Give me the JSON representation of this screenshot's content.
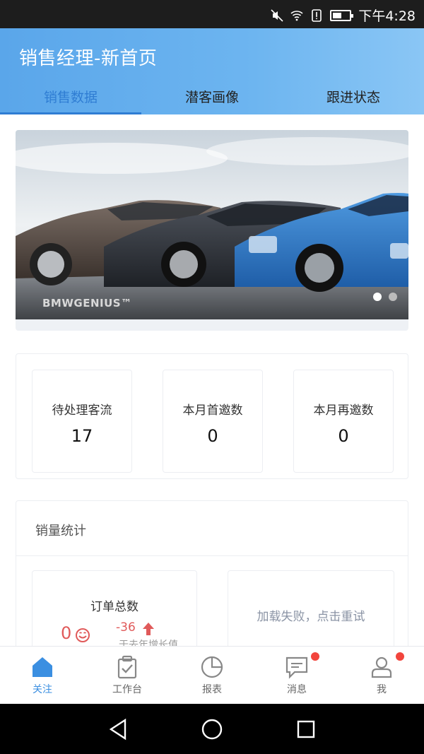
{
  "status_bar": {
    "time": "下午4:28"
  },
  "header": {
    "title": "销售经理-新首页"
  },
  "tabs": [
    {
      "label": "销售数据",
      "active": true
    },
    {
      "label": "潜客画像",
      "active": false
    },
    {
      "label": "跟进状态",
      "active": false
    }
  ],
  "banner": {
    "brand_text": "BMWGENIUS™",
    "dots": 2,
    "active_dot": 1
  },
  "stats": [
    {
      "label": "待处理客流",
      "value": "17"
    },
    {
      "label": "本月首邀数",
      "value": "0"
    },
    {
      "label": "本月再邀数",
      "value": "0"
    }
  ],
  "sales": {
    "title": "销量统计",
    "order": {
      "title": "订单总数",
      "value": "0",
      "delta": "-36",
      "note": "于去年增长值"
    },
    "fail_text": "加载失败，点击重试"
  },
  "bottom_nav": [
    {
      "label": "关注",
      "icon": "home-icon",
      "active": true,
      "badge": false
    },
    {
      "label": "工作台",
      "icon": "clipboard-icon",
      "active": false,
      "badge": false
    },
    {
      "label": "报表",
      "icon": "pie-chart-icon",
      "active": false,
      "badge": false
    },
    {
      "label": "消息",
      "icon": "message-icon",
      "active": false,
      "badge": true
    },
    {
      "label": "我",
      "icon": "user-icon",
      "active": false,
      "badge": true
    }
  ],
  "colors": {
    "accent": "#3b8fe1",
    "header_start": "#5aa6ea",
    "badge": "#f2453d",
    "negative": "#e05a5a"
  }
}
